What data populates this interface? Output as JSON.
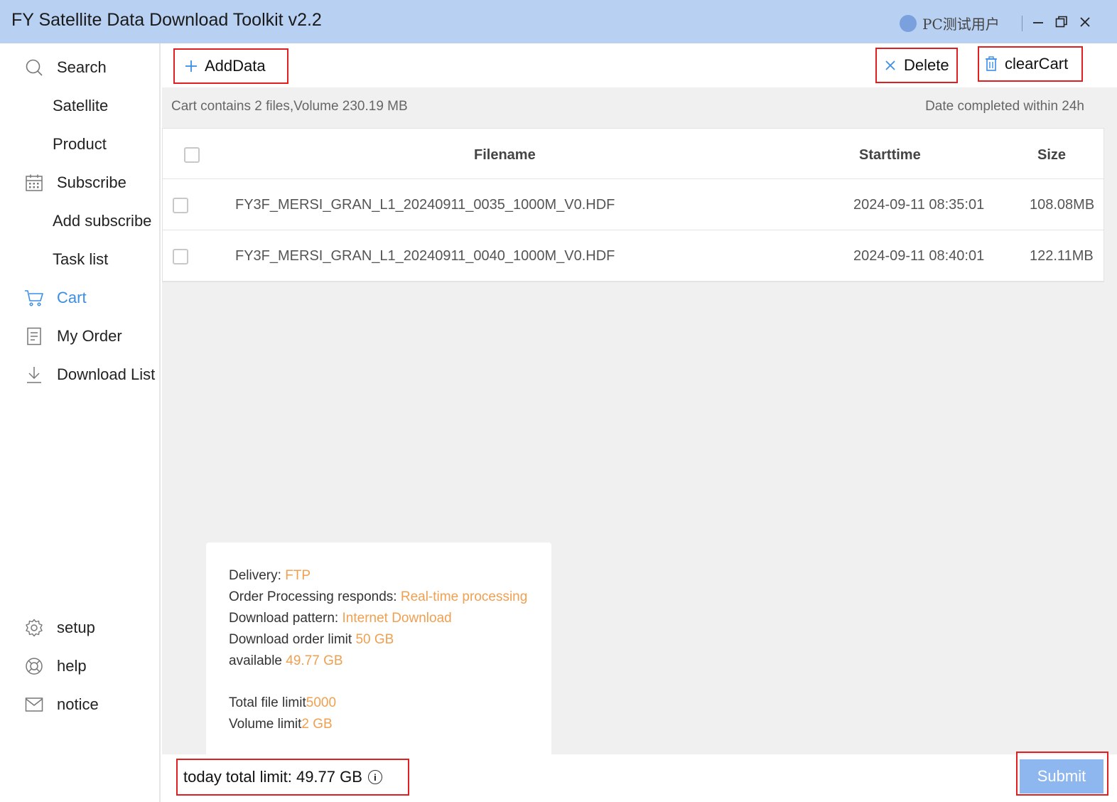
{
  "window": {
    "title": "FY Satellite Data Download Toolkit v2.2",
    "user": "PC测试用户"
  },
  "sidebar": {
    "items": [
      {
        "label": "Search",
        "icon": "search-icon"
      },
      {
        "label": "Satellite"
      },
      {
        "label": "Product"
      },
      {
        "label": "Subscribe",
        "icon": "calendar-icon"
      },
      {
        "label": "Add subscribe"
      },
      {
        "label": "Task list"
      },
      {
        "label": "Cart",
        "icon": "cart-icon",
        "active": true
      },
      {
        "label": "My Order",
        "icon": "document-icon"
      },
      {
        "label": "Download List",
        "icon": "download-icon"
      }
    ],
    "bottom": [
      {
        "label": "setup",
        "icon": "gear-icon"
      },
      {
        "label": "help",
        "icon": "lifebuoy-icon"
      },
      {
        "label": "notice",
        "icon": "mail-icon"
      }
    ]
  },
  "toolbar": {
    "add_label": "AddData",
    "delete_label": "Delete",
    "clear_label": "clearCart"
  },
  "cart": {
    "summary": "Cart contains 2 files,Volume 230.19 MB",
    "note": "Date completed within 24h"
  },
  "table": {
    "headers": {
      "filename": "Filename",
      "starttime": "Starttime",
      "size": "Size"
    },
    "rows": [
      {
        "filename": "FY3F_MERSI_GRAN_L1_20240911_0035_1000M_V0.HDF",
        "starttime": "2024-09-11 08:35:01",
        "size": "108.08MB"
      },
      {
        "filename": "FY3F_MERSI_GRAN_L1_20240911_0040_1000M_V0.HDF",
        "starttime": "2024-09-11 08:40:01",
        "size": "122.11MB"
      }
    ]
  },
  "info": {
    "delivery_label": "Delivery: ",
    "delivery_value": "FTP",
    "processing_label": "Order Processing responds: ",
    "processing_value": "Real-time processing",
    "pattern_label": "Download pattern: ",
    "pattern_value": "Internet Download",
    "order_limit_label": "Download order limit ",
    "order_limit_value": "50 GB",
    "available_label": "available ",
    "available_value": "49.77 GB",
    "file_limit_label": "Total file limit",
    "file_limit_value": "5000",
    "volume_limit_label": "Volume limit",
    "volume_limit_value": "2 GB"
  },
  "footer": {
    "limit_text": "today total limit: 49.77 GB",
    "submit_label": "Submit"
  },
  "colors": {
    "titlebar": "#b8d0f2",
    "accent": "#3a8ee6",
    "highlight": "#f0a050",
    "annotation_border": "#e02020",
    "submit": "#8fb7ef"
  }
}
